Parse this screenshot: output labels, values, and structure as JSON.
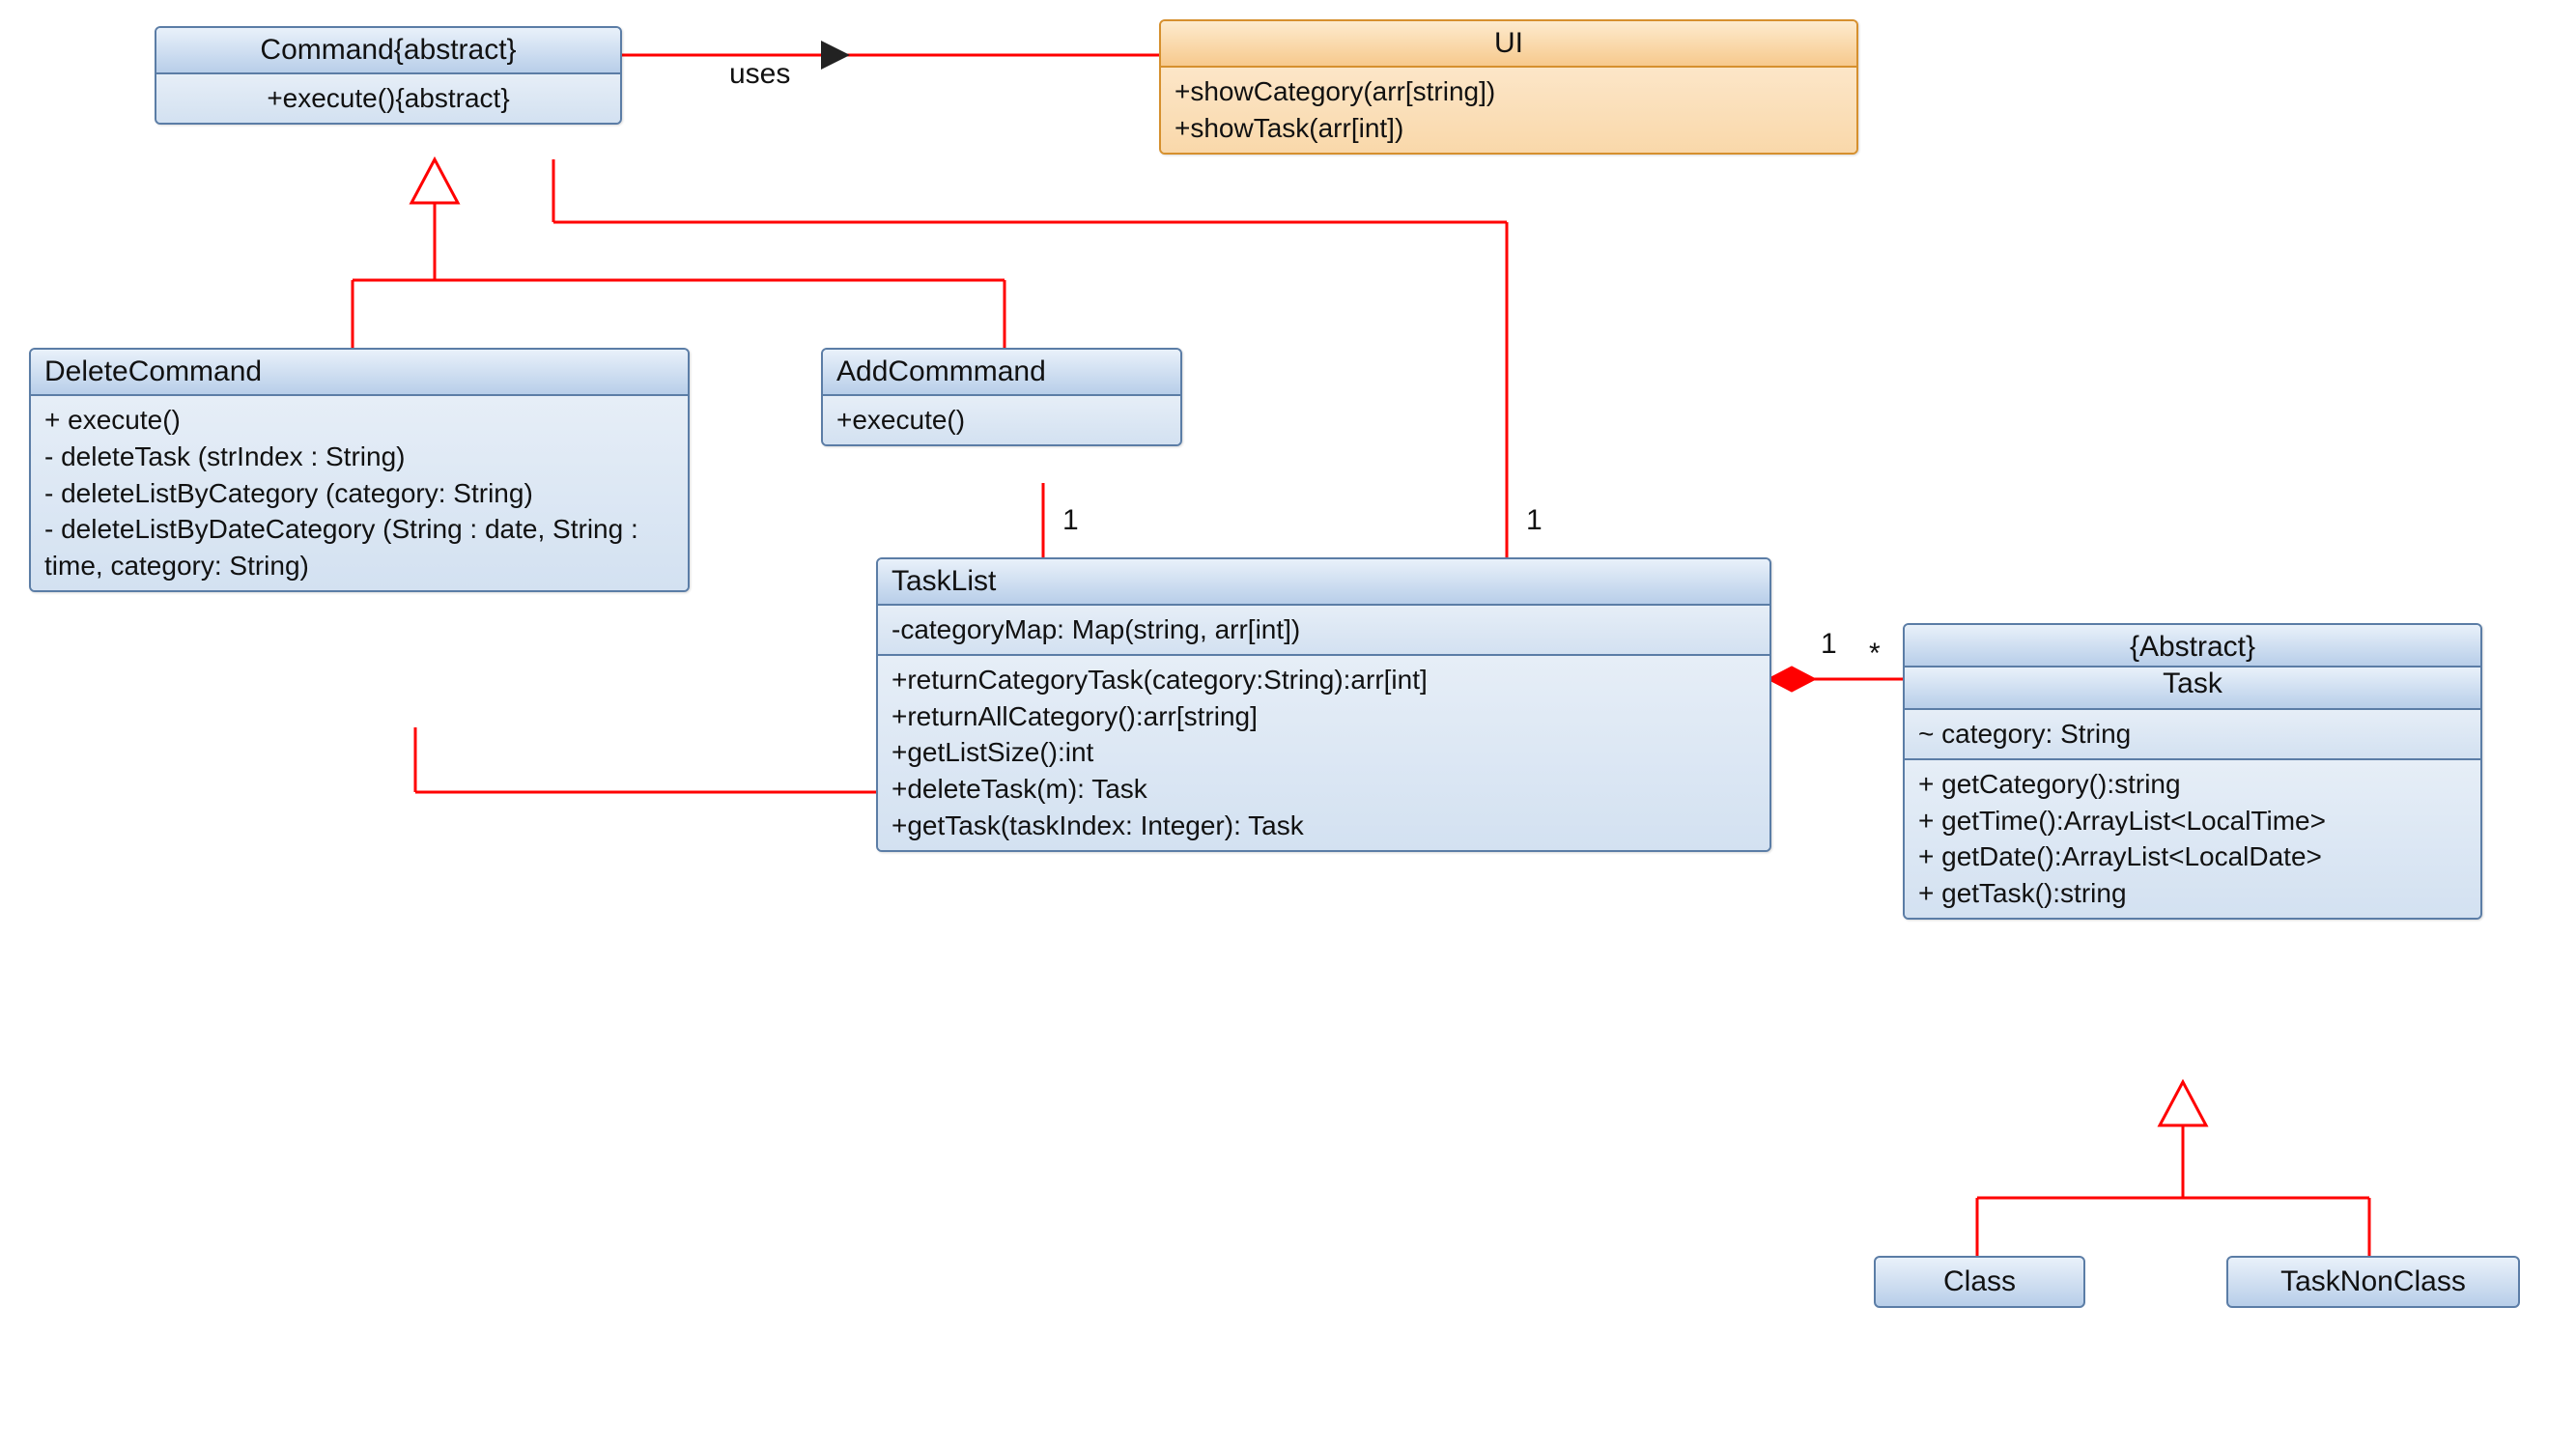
{
  "command": {
    "title": "Command{abstract}",
    "methods": "+execute(){abstract}"
  },
  "ui": {
    "title": "UI",
    "methods": "+showCategory(arr[string])\n+showTask(arr[int])"
  },
  "usesLabel": "uses",
  "deleteCommand": {
    "title": "DeleteCommand",
    "methods": "+ execute()\n- deleteTask (strIndex : String)\n- deleteListByCategory (category: String)\n- deleteListByDateCategory (String : date, String : time, category: String)"
  },
  "addCommand": {
    "title": "AddCommmand",
    "methods": "+execute()"
  },
  "taskList": {
    "title": "TaskList",
    "attrs": "-categoryMap: Map(string, arr[int])",
    "methods": "+returnCategoryTask(category:String):arr[int]\n+returnAllCategory():arr[string]\n+getListSize():int\n+deleteTask(m): Task\n+getTask(taskIndex: Integer): Task"
  },
  "task": {
    "title1": "{Abstract}",
    "title2": "Task",
    "attrs": "~ category: String",
    "methods": "+ getCategory():string\n+ getTime():ArrayList<LocalTime>\n+ getDate():ArrayList<LocalDate>\n+ getTask():string"
  },
  "classBox": "Class",
  "taskNonClassBox": "TaskNonClass",
  "mult": {
    "one": "1",
    "star": "*"
  }
}
